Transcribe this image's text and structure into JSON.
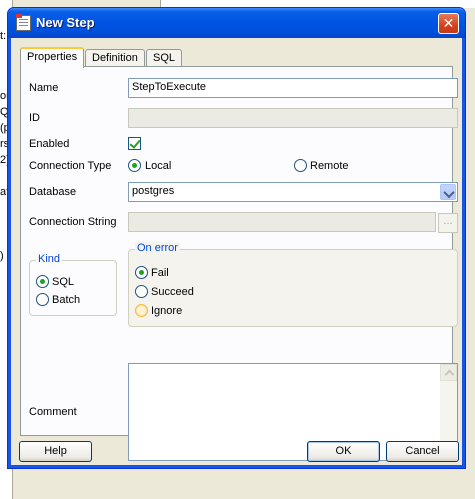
{
  "dialog": {
    "title": "New Step",
    "close_label": "✕"
  },
  "tabs": [
    {
      "label": "Properties"
    },
    {
      "label": "Definition"
    },
    {
      "label": "SQL"
    }
  ],
  "form": {
    "name_label": "Name",
    "name_value": "StepToExecute",
    "id_label": "ID",
    "id_value": "",
    "enabled_label": "Enabled",
    "enabled_checked": true,
    "connection_type_label": "Connection Type",
    "conn_local_label": "Local",
    "conn_remote_label": "Remote",
    "database_label": "Database",
    "database_value": "postgres",
    "connection_string_label": "Connection String",
    "connection_string_value": "",
    "ellipsis_label": "...",
    "comment_label": "Comment",
    "comment_value": ""
  },
  "kind": {
    "title": "Kind",
    "sql_label": "SQL",
    "batch_label": "Batch"
  },
  "on_error": {
    "title": "On error",
    "fail_label": "Fail",
    "succeed_label": "Succeed",
    "ignore_label": "Ignore"
  },
  "buttons": {
    "help": "Help",
    "ok": "OK",
    "cancel": "Cancel"
  },
  "background": {
    "fragments": [
      "t:",
      "or",
      "QL",
      "(p",
      "rs",
      "2)",
      "atic",
      ")"
    ]
  },
  "colors": {
    "title_bar": "#0054e3",
    "check_green": "#21a121",
    "group_title": "#0046d5"
  }
}
